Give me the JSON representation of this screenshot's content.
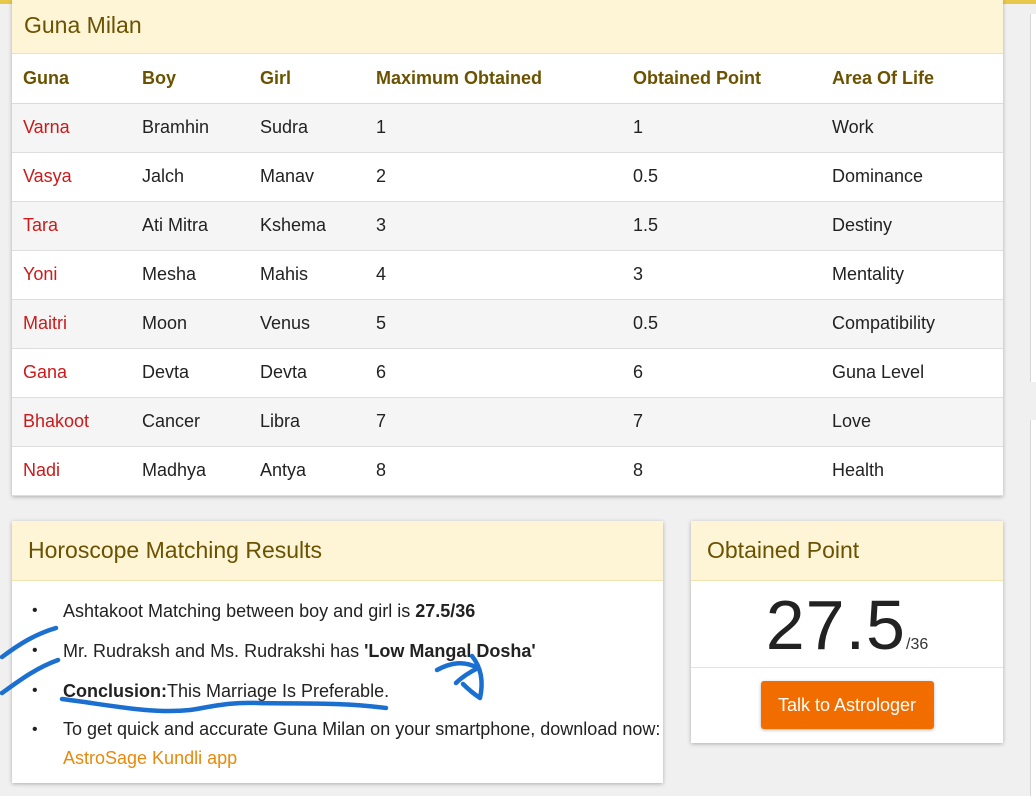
{
  "guna_milan": {
    "title": "Guna Milan",
    "headers": [
      "Guna",
      "Boy",
      "Girl",
      "Maximum Obtained",
      "Obtained Point",
      "Area Of Life"
    ],
    "rows": [
      [
        "Varna",
        "Bramhin",
        "Sudra",
        "1",
        "1",
        "Work"
      ],
      [
        "Vasya",
        "Jalch",
        "Manav",
        "2",
        "0.5",
        "Dominance"
      ],
      [
        "Tara",
        "Ati Mitra",
        "Kshema",
        "3",
        "1.5",
        "Destiny"
      ],
      [
        "Yoni",
        "Mesha",
        "Mahis",
        "4",
        "3",
        "Mentality"
      ],
      [
        "Maitri",
        "Moon",
        "Venus",
        "5",
        "0.5",
        "Compatibility"
      ],
      [
        "Gana",
        "Devta",
        "Devta",
        "6",
        "6",
        "Guna Level"
      ],
      [
        "Bhakoot",
        "Cancer",
        "Libra",
        "7",
        "7",
        "Love"
      ],
      [
        "Nadi",
        "Madhya",
        "Antya",
        "8",
        "8",
        "Health"
      ]
    ]
  },
  "results": {
    "title": "Horoscope Matching Results",
    "item1_text": "Ashtakoot Matching between boy and girl is ",
    "item1_bold": "27.5/36",
    "item2_text": "Mr. Rudraksh and Ms. Rudrakshi has ",
    "item2_bold": "'Low Mangal Dosha'",
    "item3_bold": "Conclusion:",
    "item3_text": "This Marriage Is Preferable.",
    "item4_text": "To get quick and accurate Guna Milan on your smartphone, download now: ",
    "item4_link": "AstroSage Kundli app"
  },
  "points": {
    "title": "Obtained Point",
    "score": "27.5",
    "max": "/36",
    "cta": "Talk to Astrologer"
  },
  "colors": {
    "guna_name": "#cc1a1a",
    "header_text": "#6b5200",
    "header_bg": "#fdf5d6",
    "cta": "#f26d00",
    "link": "#e8890c",
    "annotation_ink": "#1a6fd0"
  }
}
